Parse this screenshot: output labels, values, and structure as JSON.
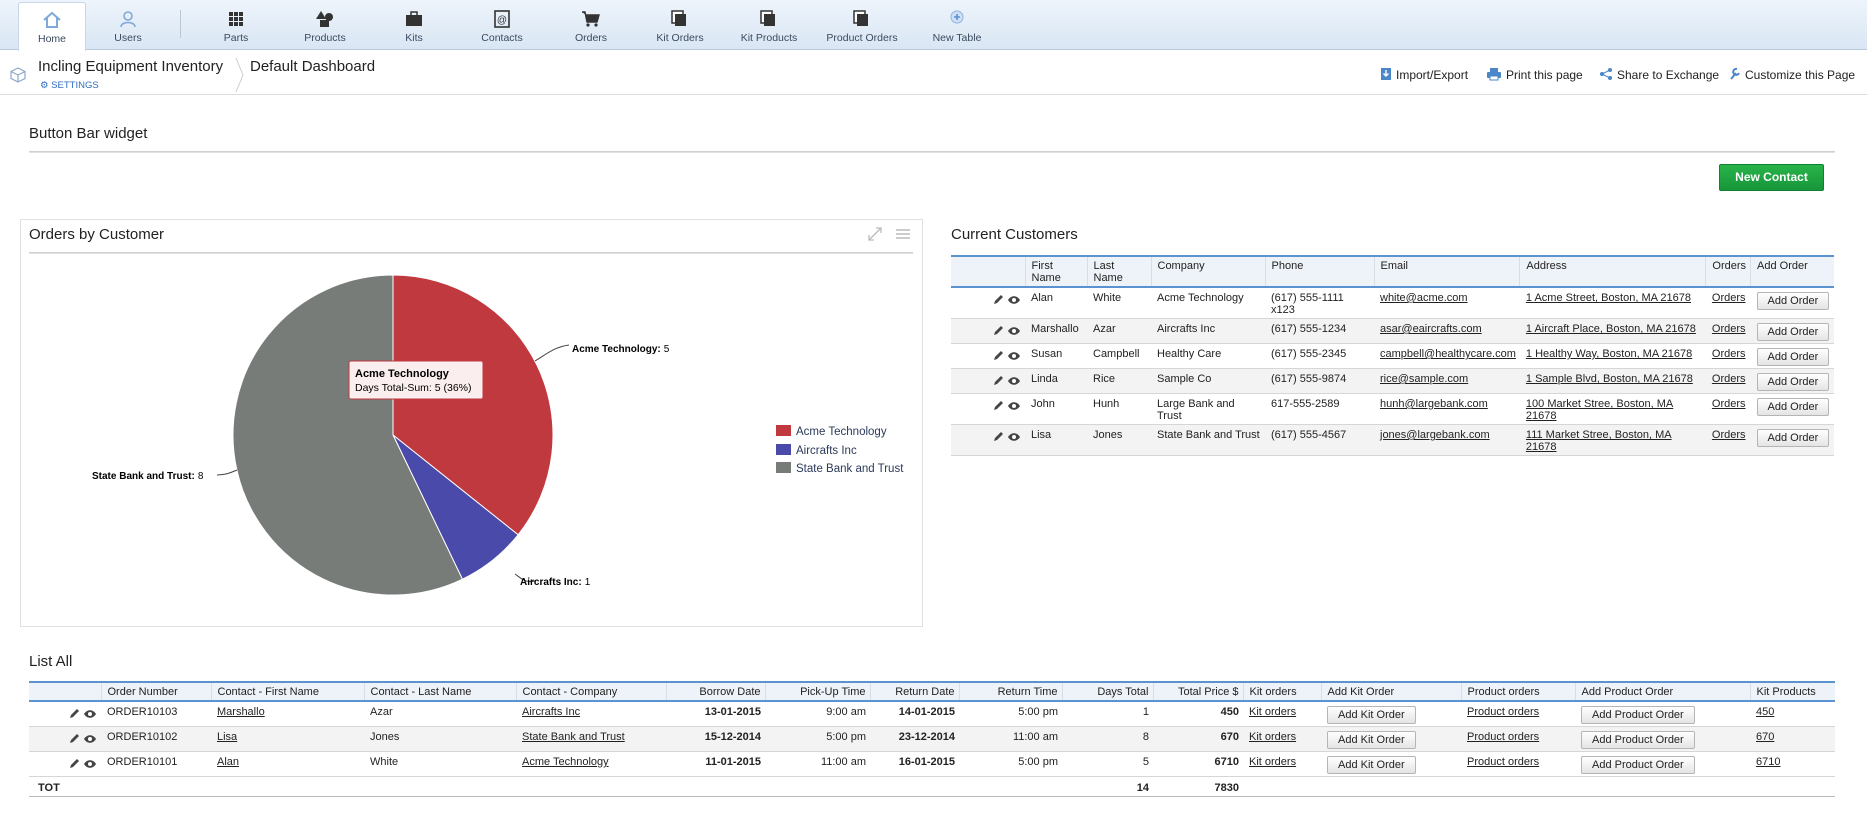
{
  "nav": {
    "items": [
      {
        "label": "Home",
        "icon": "home-icon"
      },
      {
        "label": "Users",
        "icon": "user-icon"
      },
      {
        "label": "Parts",
        "icon": "grid-icon"
      },
      {
        "label": "Products",
        "icon": "shapes-icon"
      },
      {
        "label": "Kits",
        "icon": "briefcase-icon"
      },
      {
        "label": "Contacts",
        "icon": "contacts-book-icon"
      },
      {
        "label": "Orders",
        "icon": "cart-icon"
      },
      {
        "label": "Kit Orders",
        "icon": "stacked-pages-icon"
      },
      {
        "label": "Kit Products",
        "icon": "stacked-pages-icon"
      },
      {
        "label": "Product Orders",
        "icon": "stacked-pages-icon"
      },
      {
        "label": "New Table",
        "icon": "plus-circle-icon"
      }
    ]
  },
  "header": {
    "app_title": "Incling Equipment Inventory",
    "settings_label": "SETTINGS",
    "dashboard_title": "Default Dashboard",
    "links": {
      "import_export": "Import/Export",
      "print": "Print this page",
      "share": "Share to Exchange",
      "customize": "Customize this Page"
    }
  },
  "button_bar": {
    "title": "Button Bar widget",
    "new_contact_label": "New Contact"
  },
  "orders_by_customer": {
    "title": "Orders by Customer",
    "tooltip": {
      "title": "Acme Technology",
      "text": "Days Total-Sum: 5 (36%)"
    },
    "slice_labels": {
      "acme": {
        "name": "Acme Technology:",
        "value": "5"
      },
      "aircrafts": {
        "name": "Aircrafts Inc:",
        "value": "1"
      },
      "state": {
        "name": "State Bank and Trust:",
        "value": "8"
      }
    }
  },
  "chart_data": {
    "type": "pie",
    "title": "Orders by Customer",
    "categories": [
      "Acme Technology",
      "Aircrafts Inc",
      "State Bank and Trust"
    ],
    "values": [
      5,
      1,
      8
    ],
    "colors": [
      "#c0393f",
      "#4a4aaa",
      "#787c78"
    ],
    "legend_position": "right"
  },
  "current_customers": {
    "title": "Current Customers",
    "columns": [
      "First Name",
      "Last Name",
      "Company",
      "Phone",
      "Email",
      "Address",
      "Orders",
      "Add Order"
    ],
    "rows": [
      {
        "first": "Alan",
        "last": "White",
        "company": "Acme Technology",
        "phone": "(617) 555-1111 x123",
        "email": "white@acme.com",
        "address": "1 Acme Street, Boston, MA 21678",
        "orders": "Orders",
        "add": "Add  Order"
      },
      {
        "first": "Marshallo",
        "last": "Azar",
        "company": "Aircrafts Inc",
        "phone": "(617) 555-1234",
        "email": "asar@eaircrafts.com",
        "address": "1 Aircraft Place, Boston, MA 21678",
        "orders": "Orders",
        "add": "Add  Order"
      },
      {
        "first": "Susan",
        "last": "Campbell",
        "company": "Healthy Care",
        "phone": "(617) 555-2345",
        "email": "campbell@healthycare.com",
        "address": "1 Healthy Way, Boston, MA 21678",
        "orders": "Orders",
        "add": "Add  Order"
      },
      {
        "first": "Linda",
        "last": "Rice",
        "company": "Sample Co",
        "phone": "(617) 555-9874",
        "email": "rice@sample.com",
        "address": "1 Sample Blvd, Boston, MA 21678",
        "orders": "Orders",
        "add": "Add  Order"
      },
      {
        "first": "John",
        "last": "Hunh",
        "company": "Large Bank and Trust",
        "phone": "617-555-2589",
        "email": "hunh@largebank.com",
        "address": "100 Market Stree, Boston, MA 21678",
        "orders": "Orders",
        "add": "Add  Order"
      },
      {
        "first": "Lisa",
        "last": "Jones",
        "company": "State Bank and Trust",
        "phone": "(617) 555-4567",
        "email": "jones@largebank.com",
        "address": "111 Market Stree, Boston, MA 21678",
        "orders": "Orders",
        "add": "Add  Order"
      }
    ]
  },
  "list_all": {
    "title": "List All",
    "columns": [
      "Order Number",
      "Contact - First Name",
      "Contact - Last Name",
      "Contact - Company",
      "Borrow Date",
      "Pick-Up Time",
      "Return Date",
      "Return Time",
      "Days Total",
      "Total Price $",
      "Kit orders",
      "Add Kit Order",
      "Product orders",
      "Add Product Order",
      "Kit Products"
    ],
    "rows": [
      {
        "order": "ORDER10103",
        "first": "Marshallo",
        "last": "Azar",
        "company": "Aircrafts Inc",
        "borrow": "13-01-2015",
        "pickup": "9:00 am",
        "return_date": "14-01-2015",
        "return_time": "5:00 pm",
        "days": "1",
        "price": "450",
        "kit_orders": "Kit orders",
        "add_kit": "Add  Kit Order",
        "product_orders": "Product orders",
        "add_product": "Add  Product Order",
        "kit_products": "450"
      },
      {
        "order": "ORDER10102",
        "first": "Lisa",
        "last": "Jones",
        "company": "State Bank and Trust",
        "borrow": "15-12-2014",
        "pickup": "5:00 pm",
        "return_date": "23-12-2014",
        "return_time": "11:00 am",
        "days": "8",
        "price": "670",
        "kit_orders": "Kit orders",
        "add_kit": "Add  Kit Order",
        "product_orders": "Product orders",
        "add_product": "Add  Product Order",
        "kit_products": "670"
      },
      {
        "order": "ORDER10101",
        "first": "Alan",
        "last": "White",
        "company": "Acme Technology",
        "borrow": "11-01-2015",
        "pickup": "11:00 am",
        "return_date": "16-01-2015",
        "return_time": "5:00 pm",
        "days": "5",
        "price": "6710",
        "kit_orders": "Kit orders",
        "add_kit": "Add  Kit Order",
        "product_orders": "Product orders",
        "add_product": "Add  Product Order",
        "kit_products": "6710"
      }
    ],
    "totals": {
      "label": "TOT",
      "days": "14",
      "price": "7830"
    }
  },
  "colors": {
    "accent_blue": "#5a93d0",
    "green_button": "#1a9e3d",
    "acme": "#c0393f",
    "aircrafts": "#4a4aaa",
    "state_bank": "#787c78"
  }
}
